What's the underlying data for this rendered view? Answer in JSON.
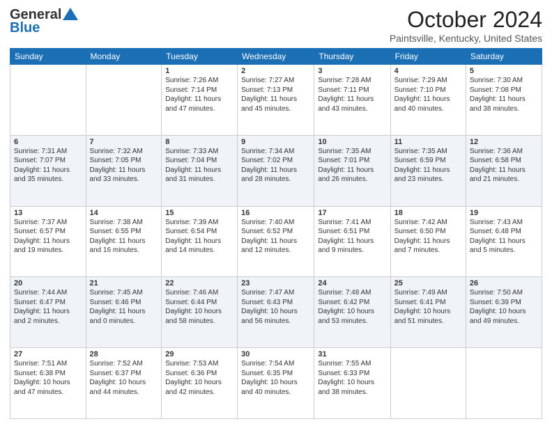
{
  "header": {
    "logo_general": "General",
    "logo_blue": "Blue",
    "title": "October 2024",
    "location": "Paintsville, Kentucky, United States"
  },
  "weekdays": [
    "Sunday",
    "Monday",
    "Tuesday",
    "Wednesday",
    "Thursday",
    "Friday",
    "Saturday"
  ],
  "weeks": [
    [
      {
        "day": "",
        "info": ""
      },
      {
        "day": "",
        "info": ""
      },
      {
        "day": "1",
        "info": "Sunrise: 7:26 AM\nSunset: 7:14 PM\nDaylight: 11 hours\nand 47 minutes."
      },
      {
        "day": "2",
        "info": "Sunrise: 7:27 AM\nSunset: 7:13 PM\nDaylight: 11 hours\nand 45 minutes."
      },
      {
        "day": "3",
        "info": "Sunrise: 7:28 AM\nSunset: 7:11 PM\nDaylight: 11 hours\nand 43 minutes."
      },
      {
        "day": "4",
        "info": "Sunrise: 7:29 AM\nSunset: 7:10 PM\nDaylight: 11 hours\nand 40 minutes."
      },
      {
        "day": "5",
        "info": "Sunrise: 7:30 AM\nSunset: 7:08 PM\nDaylight: 11 hours\nand 38 minutes."
      }
    ],
    [
      {
        "day": "6",
        "info": "Sunrise: 7:31 AM\nSunset: 7:07 PM\nDaylight: 11 hours\nand 35 minutes."
      },
      {
        "day": "7",
        "info": "Sunrise: 7:32 AM\nSunset: 7:05 PM\nDaylight: 11 hours\nand 33 minutes."
      },
      {
        "day": "8",
        "info": "Sunrise: 7:33 AM\nSunset: 7:04 PM\nDaylight: 11 hours\nand 31 minutes."
      },
      {
        "day": "9",
        "info": "Sunrise: 7:34 AM\nSunset: 7:02 PM\nDaylight: 11 hours\nand 28 minutes."
      },
      {
        "day": "10",
        "info": "Sunrise: 7:35 AM\nSunset: 7:01 PM\nDaylight: 11 hours\nand 26 minutes."
      },
      {
        "day": "11",
        "info": "Sunrise: 7:35 AM\nSunset: 6:59 PM\nDaylight: 11 hours\nand 23 minutes."
      },
      {
        "day": "12",
        "info": "Sunrise: 7:36 AM\nSunset: 6:58 PM\nDaylight: 11 hours\nand 21 minutes."
      }
    ],
    [
      {
        "day": "13",
        "info": "Sunrise: 7:37 AM\nSunset: 6:57 PM\nDaylight: 11 hours\nand 19 minutes."
      },
      {
        "day": "14",
        "info": "Sunrise: 7:38 AM\nSunset: 6:55 PM\nDaylight: 11 hours\nand 16 minutes."
      },
      {
        "day": "15",
        "info": "Sunrise: 7:39 AM\nSunset: 6:54 PM\nDaylight: 11 hours\nand 14 minutes."
      },
      {
        "day": "16",
        "info": "Sunrise: 7:40 AM\nSunset: 6:52 PM\nDaylight: 11 hours\nand 12 minutes."
      },
      {
        "day": "17",
        "info": "Sunrise: 7:41 AM\nSunset: 6:51 PM\nDaylight: 11 hours\nand 9 minutes."
      },
      {
        "day": "18",
        "info": "Sunrise: 7:42 AM\nSunset: 6:50 PM\nDaylight: 11 hours\nand 7 minutes."
      },
      {
        "day": "19",
        "info": "Sunrise: 7:43 AM\nSunset: 6:48 PM\nDaylight: 11 hours\nand 5 minutes."
      }
    ],
    [
      {
        "day": "20",
        "info": "Sunrise: 7:44 AM\nSunset: 6:47 PM\nDaylight: 11 hours\nand 2 minutes."
      },
      {
        "day": "21",
        "info": "Sunrise: 7:45 AM\nSunset: 6:46 PM\nDaylight: 11 hours\nand 0 minutes."
      },
      {
        "day": "22",
        "info": "Sunrise: 7:46 AM\nSunset: 6:44 PM\nDaylight: 10 hours\nand 58 minutes."
      },
      {
        "day": "23",
        "info": "Sunrise: 7:47 AM\nSunset: 6:43 PM\nDaylight: 10 hours\nand 56 minutes."
      },
      {
        "day": "24",
        "info": "Sunrise: 7:48 AM\nSunset: 6:42 PM\nDaylight: 10 hours\nand 53 minutes."
      },
      {
        "day": "25",
        "info": "Sunrise: 7:49 AM\nSunset: 6:41 PM\nDaylight: 10 hours\nand 51 minutes."
      },
      {
        "day": "26",
        "info": "Sunrise: 7:50 AM\nSunset: 6:39 PM\nDaylight: 10 hours\nand 49 minutes."
      }
    ],
    [
      {
        "day": "27",
        "info": "Sunrise: 7:51 AM\nSunset: 6:38 PM\nDaylight: 10 hours\nand 47 minutes."
      },
      {
        "day": "28",
        "info": "Sunrise: 7:52 AM\nSunset: 6:37 PM\nDaylight: 10 hours\nand 44 minutes."
      },
      {
        "day": "29",
        "info": "Sunrise: 7:53 AM\nSunset: 6:36 PM\nDaylight: 10 hours\nand 42 minutes."
      },
      {
        "day": "30",
        "info": "Sunrise: 7:54 AM\nSunset: 6:35 PM\nDaylight: 10 hours\nand 40 minutes."
      },
      {
        "day": "31",
        "info": "Sunrise: 7:55 AM\nSunset: 6:33 PM\nDaylight: 10 hours\nand 38 minutes."
      },
      {
        "day": "",
        "info": ""
      },
      {
        "day": "",
        "info": ""
      }
    ]
  ]
}
